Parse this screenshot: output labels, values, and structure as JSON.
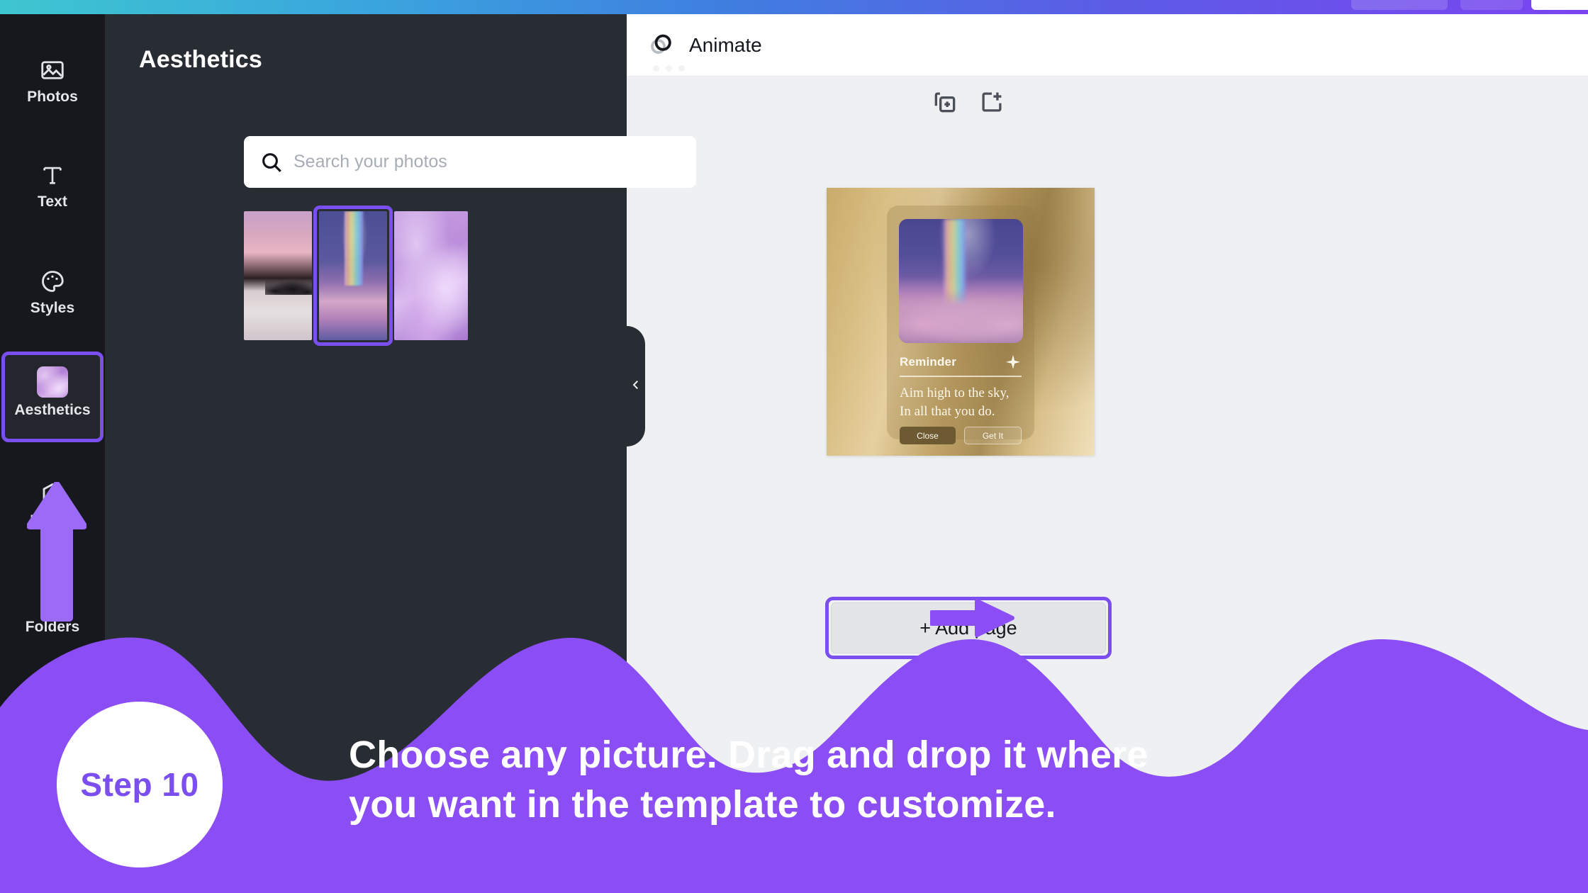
{
  "topbar": {
    "buttons": [
      "",
      "",
      ""
    ]
  },
  "rail": {
    "items": [
      {
        "label": "Photos",
        "icon": "image-icon",
        "active": false
      },
      {
        "label": "Text",
        "icon": "text-icon",
        "active": false
      },
      {
        "label": "Styles",
        "icon": "palette-icon",
        "active": false
      },
      {
        "label": "Aesthetics",
        "icon": "photo-thumbnail-icon",
        "active": true
      },
      {
        "label": "Logos",
        "icon": "logo-badge-icon",
        "active": false
      },
      {
        "label": "Folders",
        "icon": "folder-icon",
        "active": false
      }
    ],
    "highlight_color": "#7b4ef0"
  },
  "panel": {
    "title": "Aesthetics",
    "more_menu": "more-options",
    "search": {
      "placeholder": "Search your photos",
      "value": "",
      "icon": "search-icon"
    },
    "thumbnails": [
      {
        "name": "pink-beach-sunset",
        "selected": false
      },
      {
        "name": "rainbow-clouds",
        "selected": true
      },
      {
        "name": "purple-water",
        "selected": false
      }
    ],
    "collapse_icon": "chevron-left-icon"
  },
  "editor": {
    "toolbar": {
      "animate_label": "Animate",
      "animate_icon": "animate-circles-icon"
    },
    "page_tools": [
      {
        "name": "duplicate-page-icon"
      },
      {
        "name": "add-page-icon"
      }
    ],
    "canvas": {
      "card": {
        "title": "Reminder",
        "title_icon": "sparkle-icon",
        "body_line_1": "Aim high to the sky,",
        "body_line_2": "In all that you do.",
        "buttons": [
          {
            "label": "Close",
            "style": "filled"
          },
          {
            "label": "Get It",
            "style": "outline"
          }
        ]
      }
    },
    "add_page_label": "+ Add page"
  },
  "annotations": {
    "arrow_up": "up-arrow-annotation",
    "arrow_right": "right-arrow-annotation",
    "accent_color": "#8b4ef5"
  },
  "banner": {
    "step_label": "Step 10",
    "caption_line_1": "Choose any picture. Drag and drop it where",
    "caption_line_2": "you want in the template to customize.",
    "background_color": "#8b4ef5"
  }
}
